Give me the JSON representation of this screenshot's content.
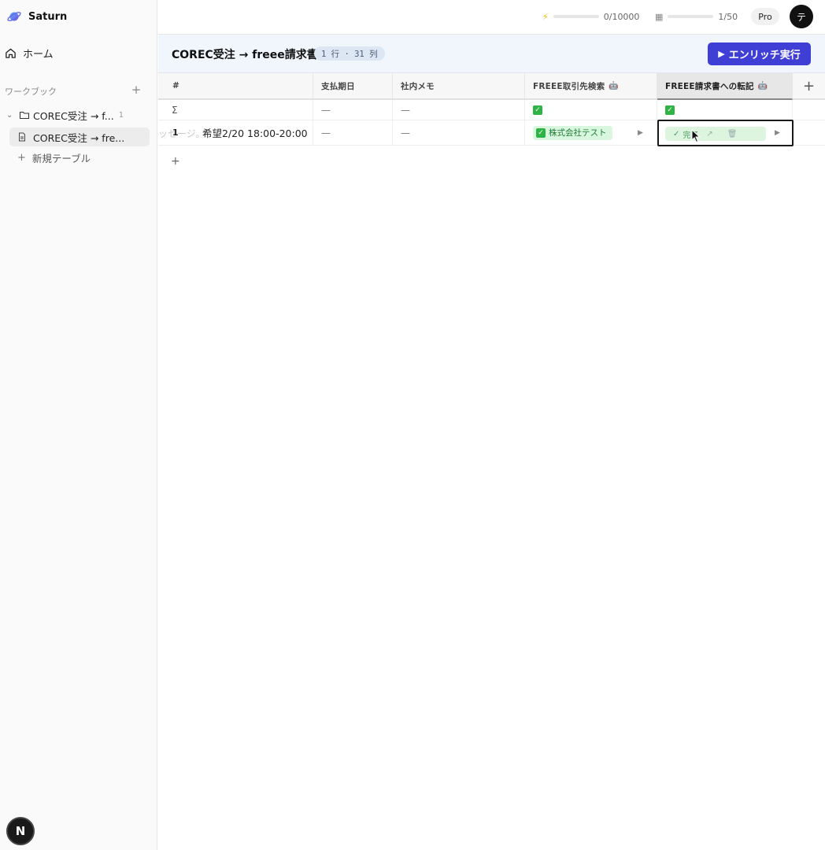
{
  "app": {
    "name": "Saturn"
  },
  "sidebar": {
    "home_label": "ホーム",
    "section_label": "ワークブック",
    "folder": {
      "label": "COREC受注 → f...",
      "count": "1"
    },
    "table_item": {
      "label": "COREC受注 → fre..."
    },
    "new_table_label": "新規テーブル",
    "bottom_badge": "N"
  },
  "topbar": {
    "credits": {
      "value": 0,
      "max": 10000,
      "label": "0/10000"
    },
    "tables": {
      "value": 1,
      "max": 50,
      "label": "1/50"
    },
    "plan": "Pro",
    "avatar_initial": "テ"
  },
  "table": {
    "title": "COREC受注 → freee請求書",
    "meta": "1 行 · 31 列",
    "enrich_button": "エンリッチ実行"
  },
  "grid": {
    "headers": [
      "#",
      "支払期日",
      "社内メモ",
      "FREEE取引先検索",
      "FREEE請求書への転記"
    ],
    "sum_symbol": "Σ",
    "sum_row": [
      "—",
      "—",
      "✅",
      "✅"
    ],
    "row1": {
      "index": "1",
      "ghost_text": "ッセージ。",
      "first_cell": "希望2/20 18:00-20:00",
      "due_date": "—",
      "memo": "—",
      "partner_chip": "株式会社テスト",
      "transfer_status": "完了"
    },
    "add_row": "+",
    "add_col": "+"
  },
  "colors": {
    "accent": "#3f3fd6",
    "success": "#2fb344"
  }
}
